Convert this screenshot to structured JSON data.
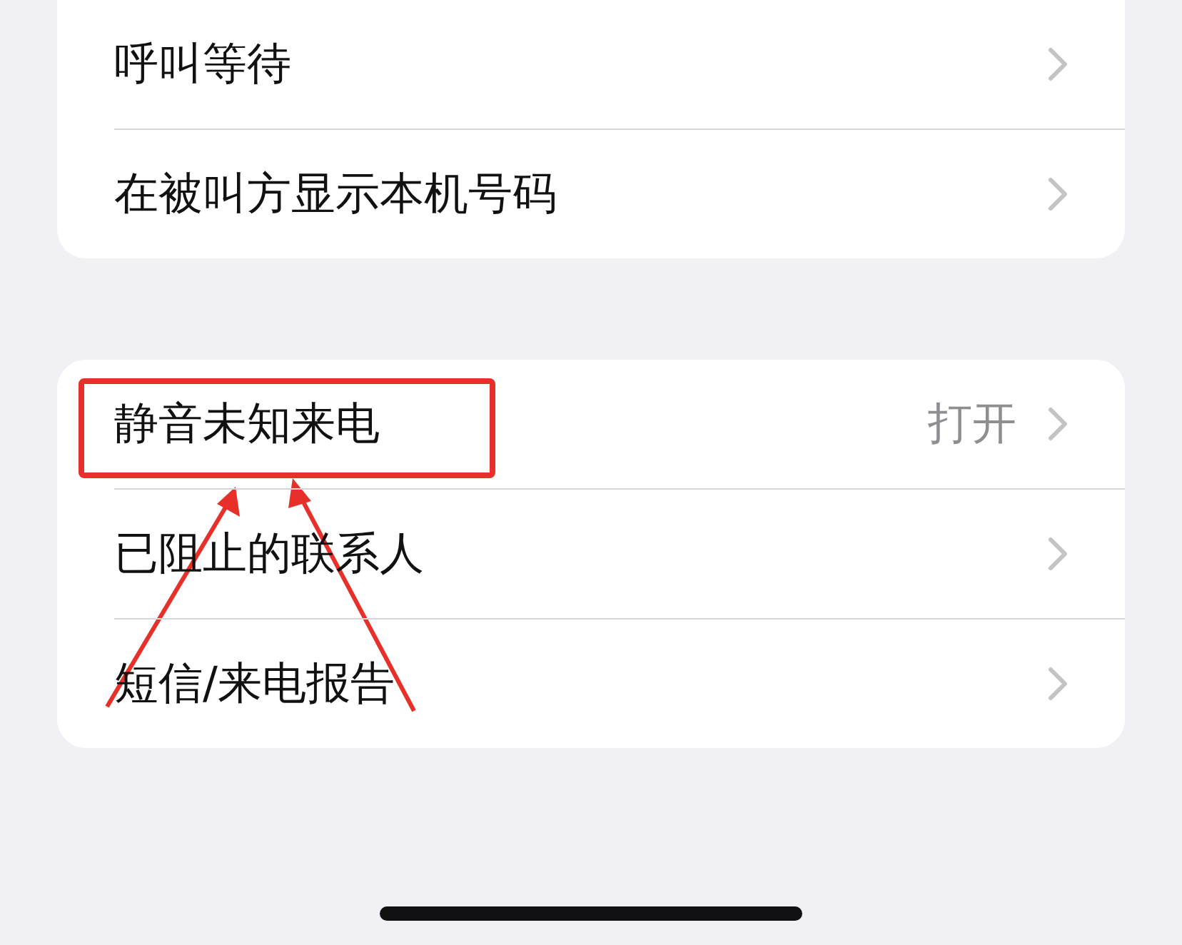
{
  "groups": [
    {
      "rows": [
        {
          "label": "呼叫等待",
          "highlighted": false
        },
        {
          "label": "在被叫方显示本机号码",
          "highlighted": false
        }
      ]
    },
    {
      "rows": [
        {
          "label": "静音未知来电",
          "value": "打开",
          "highlighted": true
        },
        {
          "label": "已阻止的联系人",
          "highlighted": false
        },
        {
          "label": "短信/来电报告",
          "highlighted": false
        }
      ]
    }
  ]
}
